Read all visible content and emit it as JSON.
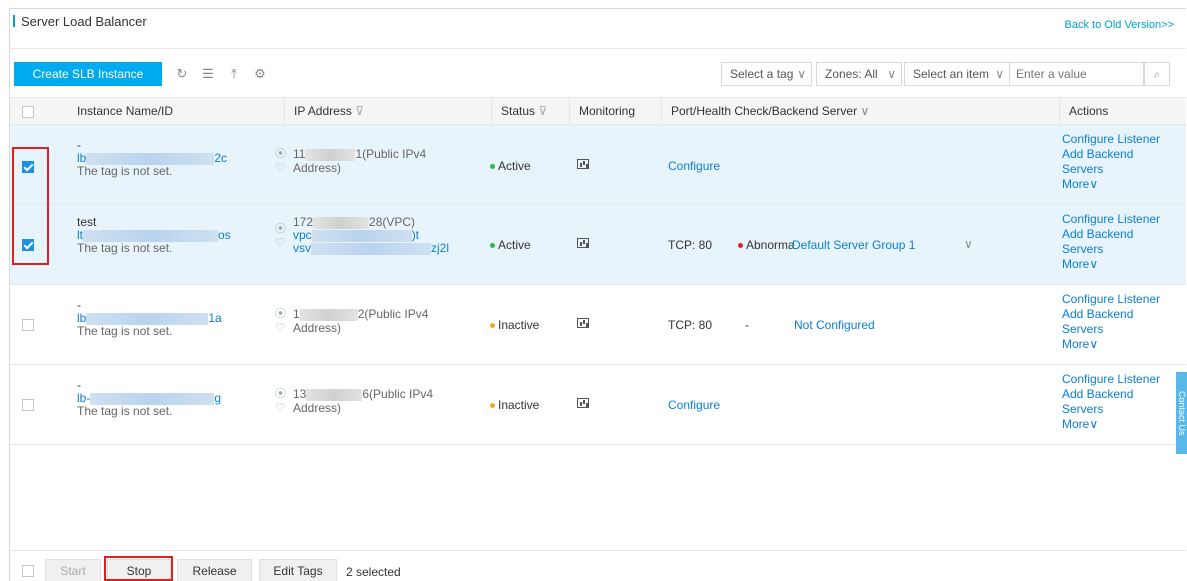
{
  "header": {
    "title": "Server Load Balancer",
    "back_link": "Back to Old Version>>"
  },
  "toolbar": {
    "create_label": "Create SLB Instance",
    "icons": [
      "refresh-icon",
      "list-icon",
      "export-icon",
      "settings-icon"
    ],
    "tag_select": "Select a tag",
    "zones_select": "Zones: All",
    "item_select": "Select an item",
    "search_placeholder": "Enter a value"
  },
  "columns": {
    "name": "Instance Name/ID",
    "ip": "IP Address",
    "status": "Status",
    "monitoring": "Monitoring",
    "port": "Port/Health Check/Backend Server",
    "actions": "Actions"
  },
  "rows": [
    {
      "checked": true,
      "name": "-",
      "id_prefix": "lb",
      "id_suffix": "2c",
      "tag": "The tag is not set.",
      "ip_prefix": "11",
      "ip_suffix": "1(Public IPv4",
      "ip_line2": "Address)",
      "status": "Active",
      "port_configure": "Configure",
      "actions": [
        "Configure Listener",
        "Add Backend",
        "Servers",
        "More"
      ]
    },
    {
      "checked": true,
      "name": "test",
      "id_prefix": "lt",
      "id_suffix": "os",
      "tag": "The tag is not set.",
      "ip_prefix": "172",
      "ip_suffix": "28(VPC)",
      "vpc_prefix": "vpc",
      "vpc_suffix": ")t",
      "vsw_prefix": "vsv",
      "vsw_suffix": "zj2l",
      "status": "Active",
      "port": "TCP: 80",
      "health": "Abnormal",
      "backend": "Default Server Group 1",
      "actions": [
        "Configure Listener",
        "Add Backend",
        "Servers",
        "More"
      ]
    },
    {
      "checked": false,
      "name": "-",
      "id_prefix": "lb",
      "id_suffix": "1a",
      "tag": "The tag is not set.",
      "ip_prefix": "1",
      "ip_suffix": "2(Public IPv4",
      "ip_line2": "Address)",
      "status": "Inactive",
      "port": "TCP: 80",
      "health": "-",
      "backend": "Not Configured",
      "actions": [
        "Configure Listener",
        "Add Backend",
        "Servers",
        "More"
      ]
    },
    {
      "checked": false,
      "name": "-",
      "id_prefix": "lb-",
      "id_suffix": "g",
      "tag": "The tag is not set.",
      "ip_prefix": "13",
      "ip_suffix": "6(Public IPv4",
      "ip_line2": "Address)",
      "status": "Inactive",
      "port_configure": "Configure",
      "actions": [
        "Configure Listener",
        "Add Backend",
        "Servers",
        "More"
      ]
    }
  ],
  "footer": {
    "start": "Start",
    "stop": "Stop",
    "release": "Release",
    "edit_tags": "Edit Tags",
    "selected": "2 selected"
  },
  "contact_tab": "Contact Us",
  "colors": {
    "accent": "#00aaee",
    "link": "#0a7ed2",
    "active": "#2db84d",
    "inactive": "#f5a623",
    "abnormal": "#e0202e",
    "highlight": "#e02020"
  }
}
